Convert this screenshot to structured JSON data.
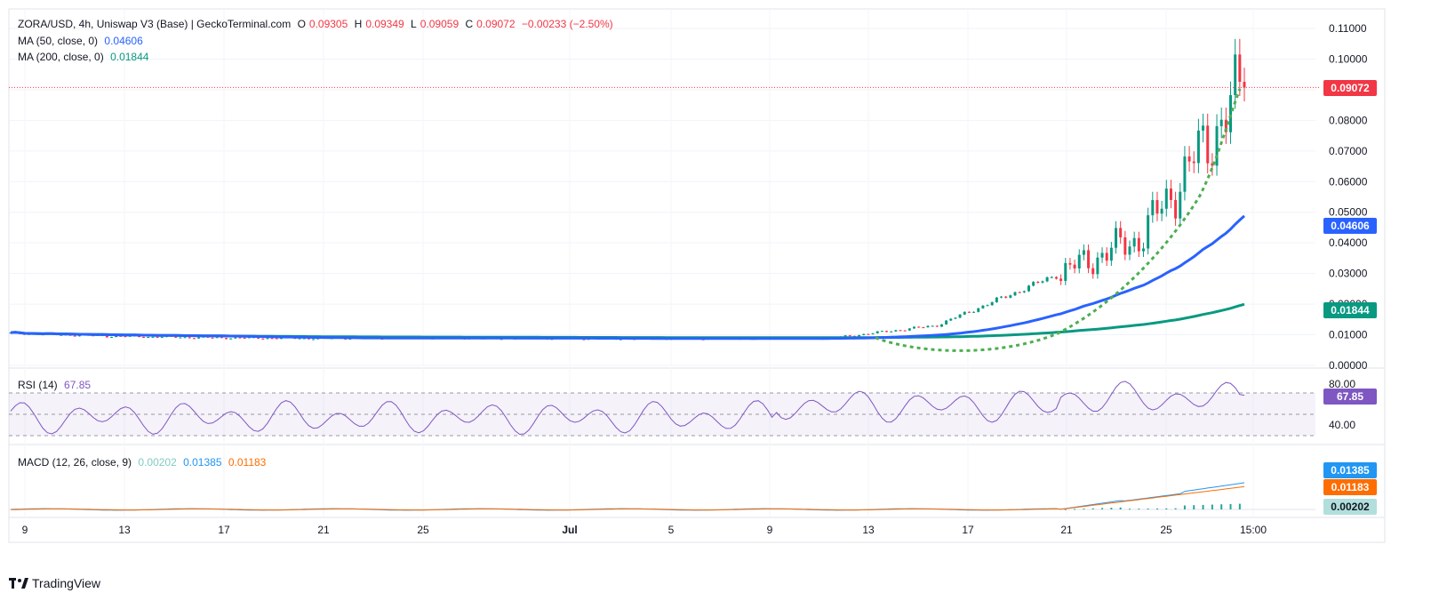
{
  "header": {
    "pair": "ZORA/USD, 4h, Uniswap V3 (Base) | GeckoTerminal.com",
    "open_label": "O",
    "open": "0.09305",
    "high_label": "H",
    "high": "0.09349",
    "low_label": "L",
    "low": "0.09059",
    "close_label": "C",
    "close": "0.09072",
    "change": "−0.00233 (−2.50%)"
  },
  "indicators": {
    "ma50": {
      "label": "MA (50, close, 0)",
      "value": "0.04606",
      "color": "#2962ff"
    },
    "ma200": {
      "label": "MA (200, close, 0)",
      "value": "0.01844",
      "color": "#089981"
    },
    "rsi": {
      "label": "RSI (14)",
      "value": "67.85",
      "color": "#7e57c2"
    },
    "macd": {
      "label": "MACD (12, 26, close, 9)",
      "hist": "0.00202",
      "macd": "0.01385",
      "signal": "0.01183",
      "hist_color": "#80cbc4",
      "macd_color": "#2196f3",
      "signal_color": "#ff6d00"
    }
  },
  "price_axis": {
    "ticks": [
      "0.11000",
      "0.10000",
      "0.09000",
      "0.08000",
      "0.07000",
      "0.06000",
      "0.05000",
      "0.04000",
      "0.03000",
      "0.02000",
      "0.01000",
      "0.00000"
    ],
    "last_price": "0.09072",
    "ma50_tag": "0.04606",
    "ma200_tag": "0.01844"
  },
  "rsi_axis": {
    "ticks": [
      "80.00",
      "40.00"
    ],
    "tag": "67.85"
  },
  "macd_axis": {
    "tags": [
      "0.01385",
      "0.01183",
      "0.00202"
    ]
  },
  "time_axis": {
    "ticks": [
      "9",
      "13",
      "17",
      "21",
      "25",
      "Jul",
      "5",
      "9",
      "13",
      "17",
      "21",
      "25",
      "15:00"
    ]
  },
  "brand": {
    "name": "TradingView"
  },
  "colors": {
    "up": "#089981",
    "down": "#f23645",
    "ma50": "#2962ff",
    "ma200": "#089981",
    "curve": "#4caf50",
    "rsi": "#7e57c2"
  },
  "chart_data": {
    "type": "candlestick",
    "title": "ZORA/USD, 4h, Uniswap V3 (Base)",
    "ylim": [
      0,
      0.11
    ],
    "x_labels": [
      "9",
      "13",
      "17",
      "21",
      "25",
      "Jul",
      "5",
      "9",
      "13",
      "17",
      "21",
      "25"
    ],
    "close_trend": [
      {
        "x": "9",
        "y": 0.0105
      },
      {
        "x": "13",
        "y": 0.0095
      },
      {
        "x": "17",
        "y": 0.009
      },
      {
        "x": "21",
        "y": 0.0088
      },
      {
        "x": "25",
        "y": 0.009
      },
      {
        "x": "Jul",
        "y": 0.0088
      },
      {
        "x": "5",
        "y": 0.0087
      },
      {
        "x": "9",
        "y": 0.0088
      },
      {
        "x": "13",
        "y": 0.009
      },
      {
        "x": "17",
        "y": 0.013
      },
      {
        "x": "21",
        "y": 0.027
      },
      {
        "x": "25",
        "y": 0.042
      },
      {
        "x": "last",
        "y": 0.09072
      }
    ],
    "series": [
      {
        "name": "MA (50, close, 0)",
        "last": 0.04606
      },
      {
        "name": "MA (200, close, 0)",
        "last": 0.01844
      }
    ],
    "rsi": {
      "last": 67.85,
      "levels": [
        70,
        50,
        30
      ]
    },
    "macd": {
      "hist": 0.00202,
      "macd": 0.01385,
      "signal": 0.01183
    }
  }
}
